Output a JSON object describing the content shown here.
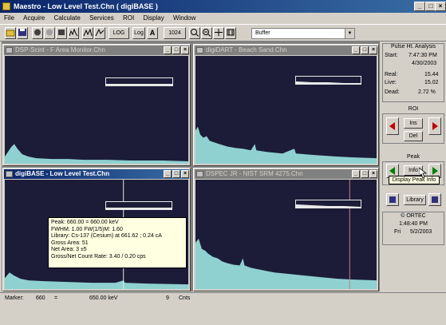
{
  "window": {
    "title": "Maestro - Low Level Test.Chn ( digiBASE )"
  },
  "menu": [
    "File",
    "Acquire",
    "Calculate",
    "Services",
    "ROI",
    "Display",
    "Window"
  ],
  "toolbar": {
    "log_label": "LOG",
    "log_state": "Log",
    "auto_label": "A",
    "zoom_value": "1024",
    "buffer_label": "Buffer"
  },
  "windows": [
    {
      "title": "DSP-Scint - F Area Monitor.Chn",
      "active": false
    },
    {
      "title": "digiDART - Beach Sand.Chn",
      "active": false
    },
    {
      "title": "digiBASE - Low Level Test.Chn",
      "active": true
    },
    {
      "title": "DSPEC JR - NIST SRM 4275.Chn",
      "active": false
    }
  ],
  "peak_info": {
    "line1": "Peak: 660.00 = 660.00 keV",
    "line2": "FWHM: 1.00  FW(1/5)M: 1.60",
    "line3": "Library: Cs-137 (Cesium) at 661.62 ;  0.24 cA",
    "line4": "Gross Area: 51",
    "line5": "Net Area: 3 ±5",
    "line6": "Gross/Net Count Rate: 3.40 / 0.20 cps"
  },
  "pulse_analysis": {
    "heading": "Pulse Ht. Analysis",
    "start_label": "Start:",
    "start_time": "7:47:30 PM",
    "start_date": "4/30/2003",
    "real_label": "Real:",
    "real_value": "15.44",
    "live_label": "Live:",
    "live_value": "15.02",
    "dead_label": "Dead:",
    "dead_value": "2.72 %"
  },
  "roi": {
    "heading": "ROI",
    "ins_label": "Ins",
    "del_label": "Del"
  },
  "peak": {
    "heading": "Peak",
    "info_label": "Info",
    "tooltip": "Display Peak Info"
  },
  "library": {
    "label": "Library"
  },
  "brand": {
    "name": "© ORTEC",
    "time": "1:48:40 PM",
    "day_label": "Fri",
    "date": "5/2/2003"
  },
  "status": {
    "marker_label": "Marker:",
    "marker_channel": "660",
    "equals": "=",
    "energy": "650.00 keV",
    "counts": "9",
    "counts_unit": "Cnts"
  },
  "colors": {
    "plot_bg": "#1c1c38",
    "spectrum": "#8fd1d1",
    "title_active": "#0a246a",
    "title_inactive": "#808080"
  }
}
